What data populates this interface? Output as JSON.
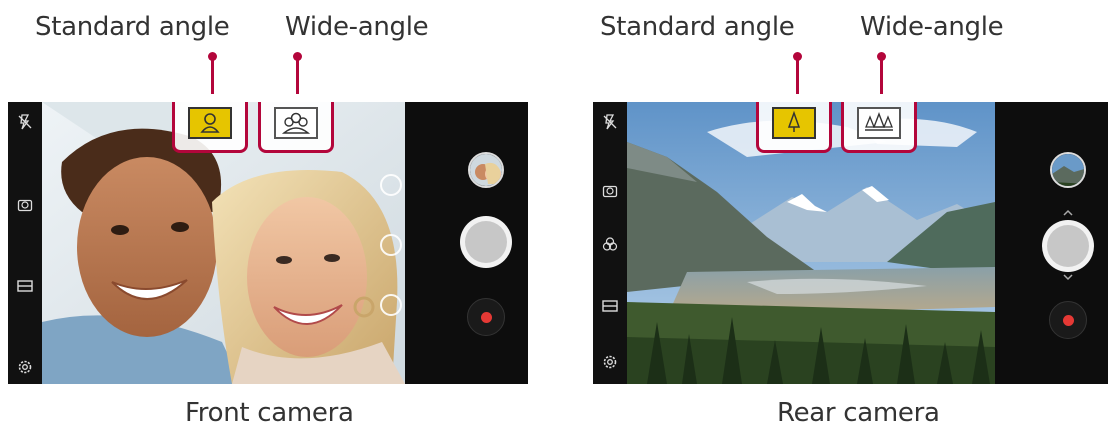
{
  "labels": {
    "standard_angle": "Standard angle",
    "wide_angle": "Wide-angle"
  },
  "captions": {
    "front": "Front camera",
    "rear": "Rear camera"
  },
  "colors": {
    "callout": "#b3063b",
    "selected_angle": "#e6c500",
    "record_red": "#e53935",
    "bar_background": "#111111"
  },
  "screens": [
    {
      "name": "front-camera",
      "selected_angle": "standard",
      "left_icons": [
        "flash-off-icon",
        "switch-camera-icon",
        "aspect-ratio-icon",
        "settings-icon"
      ],
      "overlay_icons": [
        "filter-icon",
        "beauty-icon",
        "timer-icon"
      ],
      "standard_icon": "portrait-person-icon",
      "wide_icon": "group-people-icon"
    },
    {
      "name": "rear-camera",
      "selected_angle": "standard",
      "left_icons": [
        "flash-off-icon",
        "switch-camera-icon",
        "filter-icon",
        "aspect-ratio-icon",
        "settings-icon"
      ],
      "overlay_icons": [],
      "standard_icon": "single-tree-icon",
      "wide_icon": "multiple-trees-icon"
    }
  ]
}
